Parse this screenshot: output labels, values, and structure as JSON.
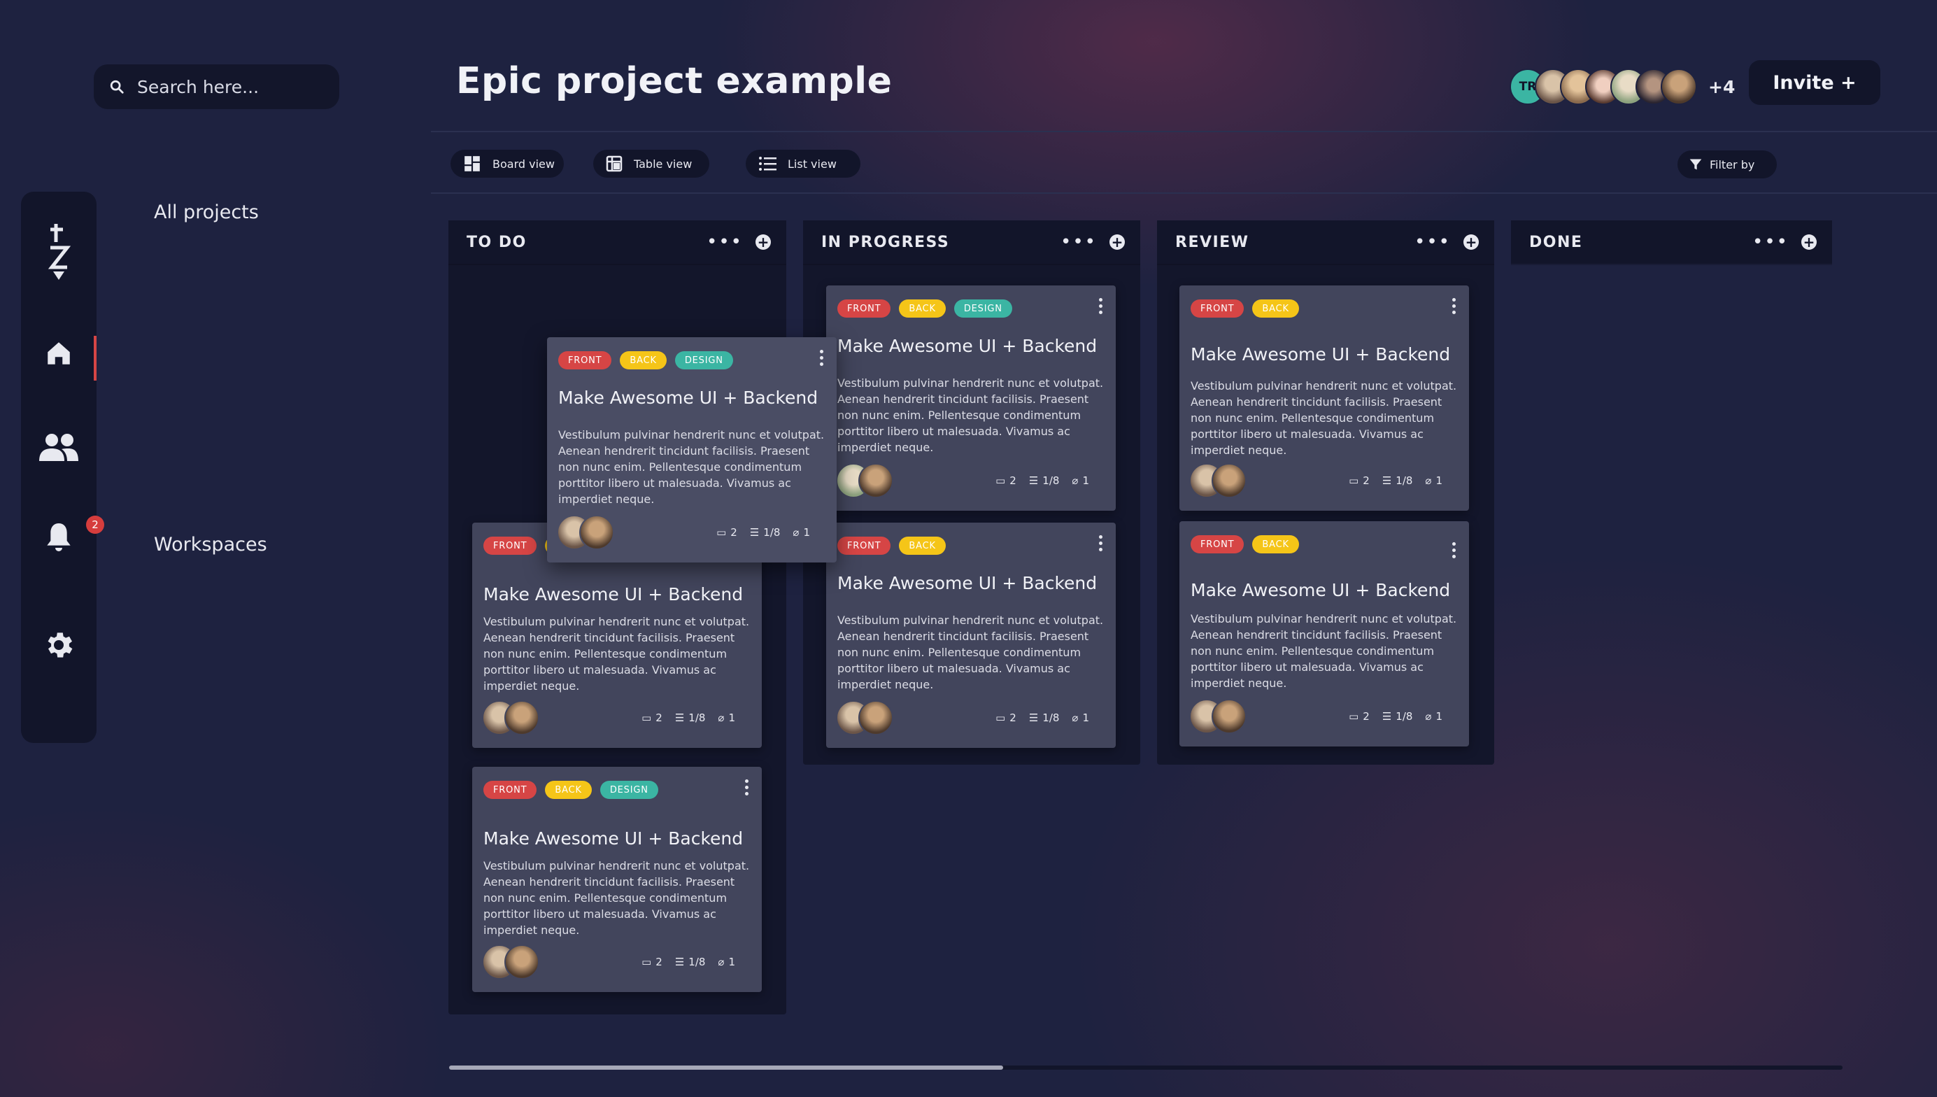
{
  "search": {
    "placeholder": "Search here..."
  },
  "sidebar": {
    "all_projects": "All projects",
    "workspaces": "Workspaces",
    "notification_count": "2"
  },
  "header": {
    "title": "Epic project example",
    "first_avatar_initials": "TR",
    "extra_members": "+4",
    "invite_label": "Invite +"
  },
  "views": {
    "board": "Board view",
    "table": "Table view",
    "list": "List view",
    "filter": "Filter by"
  },
  "columns": [
    "TO DO",
    "IN PROGRESS",
    "REVIEW",
    "DONE"
  ],
  "tags": {
    "front": "FRONT",
    "back": "BACK",
    "design": "DESIGN"
  },
  "card": {
    "title": "Make Awesome UI + Backend",
    "body": "Vestibulum pulvinar hendrerit nunc et volutpat. Aenean hendrerit tincidunt facilisis. Praesent non nunc enim. Pellentesque condimentum porttitor libero ut malesuada. Vivamus ac imperdiet neque.",
    "comments": "2",
    "tasks": "1/8",
    "attachments": "1"
  },
  "colors": {
    "background": "#1e2240",
    "panel": "#12152a",
    "card": "#42455c",
    "tag_front": "#d64545",
    "tag_back": "#f5c518",
    "tag_design": "#3bb5a3",
    "accent": "#d64545"
  }
}
